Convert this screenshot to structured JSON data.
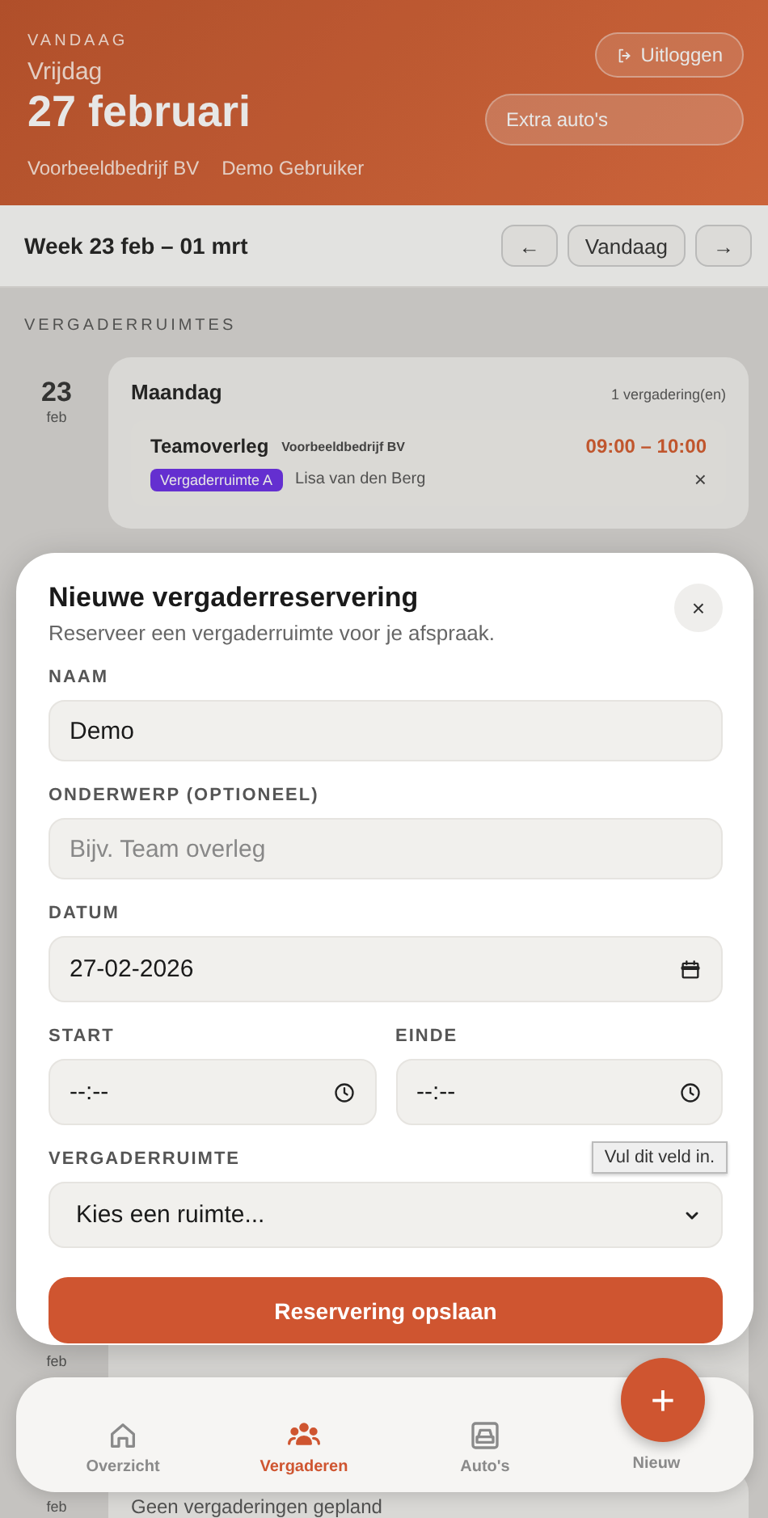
{
  "header": {
    "eyebrow": "VANDAAG",
    "weekday": "Vrijdag",
    "date": "27 februari",
    "company": "Voorbeeldbedrijf BV",
    "user": "Demo Gebruiker",
    "logout": "Uitloggen",
    "cars_select": "Extra auto's"
  },
  "week": {
    "label": "Week 23 feb – 01 mrt",
    "prev": "←",
    "today": "Vandaag",
    "next": "→"
  },
  "section": "VERGADERRUIMTES",
  "days": [
    {
      "day": "23",
      "month": "feb",
      "weekday": "Maandag",
      "count": "1 vergadering(en)",
      "meetings": [
        {
          "title": "Teamoverleg",
          "company": "Voorbeeldbedrijf BV",
          "time": "09:00 – 10:00",
          "room": "Vergaderruimte A",
          "person": "Lisa van den Berg",
          "delete": "×"
        }
      ]
    },
    {
      "month": "feb"
    },
    {
      "month": "feb",
      "empty": "Geen vergaderingen gepland"
    }
  ],
  "modal": {
    "title": "Nieuwe vergaderreservering",
    "subtitle": "Reserveer een vergaderruimte voor je afspraak.",
    "close": "×",
    "fields": [
      {
        "kind": "text",
        "label": "NAAM",
        "value": "Demo"
      },
      {
        "kind": "text",
        "label": "ONDERWERP (OPTIONEEL)",
        "placeholder": "Bijv. Team overleg"
      },
      {
        "kind": "date",
        "label": "DATUM",
        "value": "27-02-2026"
      },
      {
        "kind": "time_pair",
        "items": [
          {
            "label": "START",
            "value": "--:--"
          },
          {
            "label": "EINDE",
            "value": "--:--"
          }
        ]
      },
      {
        "kind": "select",
        "label": "VERGADERRUIMTE",
        "value": "Kies een ruimte...",
        "tooltip": "Vul dit veld in."
      }
    ],
    "submit": "Reservering opslaan"
  },
  "nav": {
    "items": [
      {
        "kind": "home",
        "label": "Overzicht",
        "selected": false
      },
      {
        "kind": "people",
        "label": "Vergaderen",
        "selected": true
      },
      {
        "kind": "car",
        "label": "Auto's",
        "selected": false
      }
    ],
    "fab": {
      "symbol": "+",
      "label": "Nieuw"
    }
  }
}
